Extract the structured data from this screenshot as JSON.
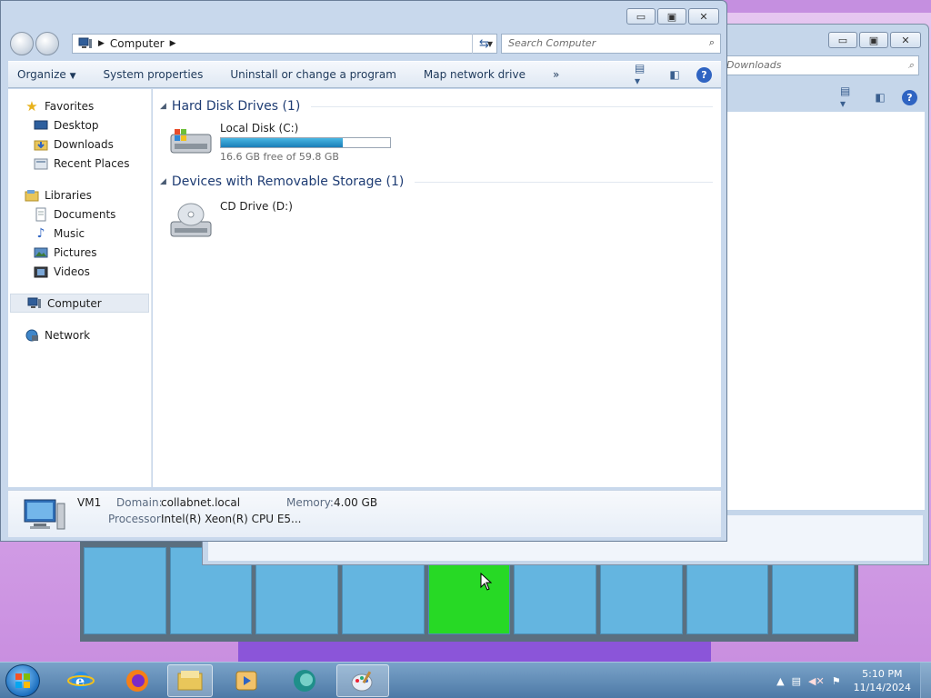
{
  "window": {
    "address": "Computer",
    "search_placeholder": "Search Computer"
  },
  "back_window": {
    "search_placeholder": "rch Downloads"
  },
  "toolbar": {
    "organize": "Organize",
    "system_properties": "System properties",
    "uninstall": "Uninstall or change a program",
    "map_drive": "Map network drive",
    "more": "»"
  },
  "navpane": {
    "favorites": "Favorites",
    "desktop": "Desktop",
    "downloads": "Downloads",
    "recent": "Recent Places",
    "libraries": "Libraries",
    "documents": "Documents",
    "music": "Music",
    "pictures": "Pictures",
    "videos": "Videos",
    "computer": "Computer",
    "network": "Network"
  },
  "content": {
    "hdd_group": "Hard Disk Drives (1)",
    "removable_group": "Devices with Removable Storage (1)",
    "local_disk": {
      "name": "Local Disk (C:)",
      "space": "16.6 GB free of 59.8 GB",
      "used_fraction": 0.72
    },
    "cd_drive": {
      "name": "CD Drive (D:)"
    }
  },
  "details": {
    "computer_name": "VM1",
    "domain_label": "Domain:",
    "domain_value": "collabnet.local",
    "memory_label": "Memory:",
    "memory_value": "4.00 GB",
    "processor_label": "Processor:",
    "processor_value": "Intel(R) Xeon(R) CPU E5..."
  },
  "taskbar": {
    "time": "5:10 PM",
    "date": "11/14/2024"
  },
  "colors": {
    "accent": "#1e3c73",
    "progress": "#1a7eb8",
    "highlight_tile": "#27d925"
  }
}
